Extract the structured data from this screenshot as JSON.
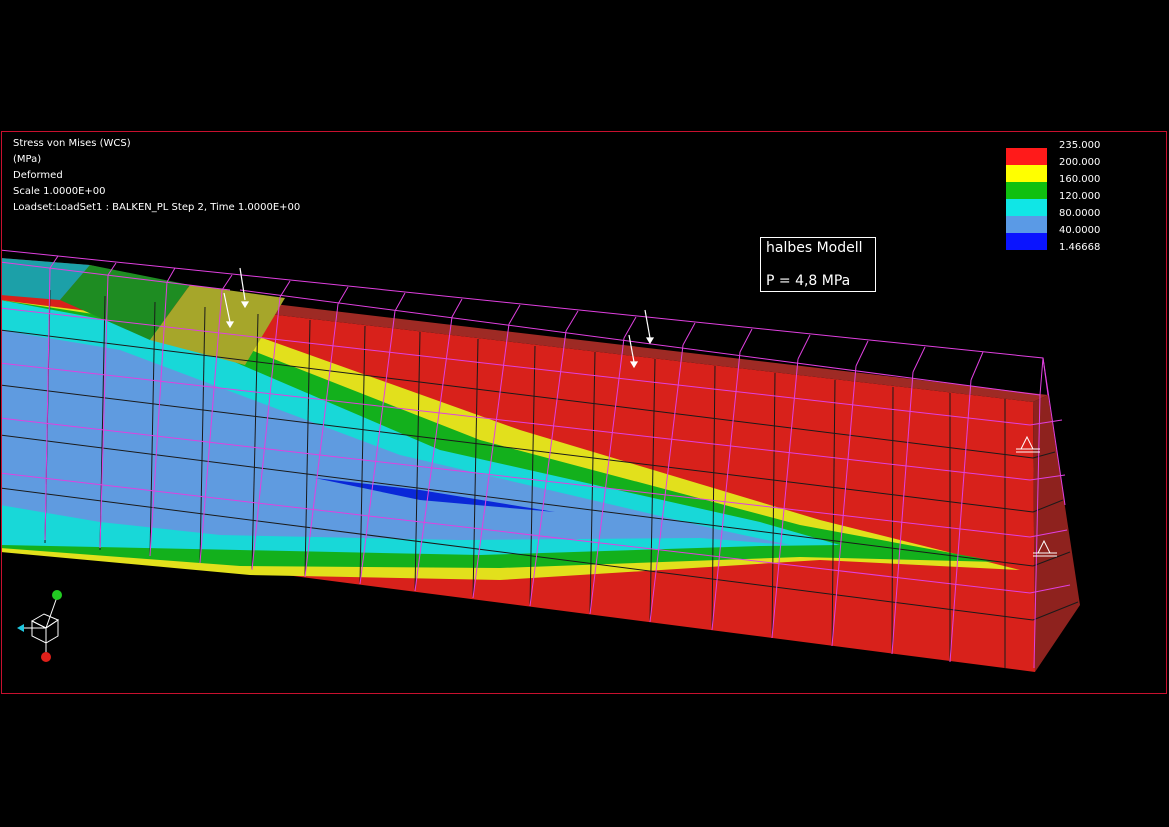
{
  "header_info": {
    "result": "Stress von Mises (WCS)",
    "unit": "(MPa)",
    "mode": "Deformed",
    "scale": "Scale  1.0000E+00",
    "loadset": "Loadset:LoadSet1 :  BALKEN_PL Step 2, Time  1.0000E+00"
  },
  "legend": {
    "labels": [
      "235.000",
      "200.000",
      "160.000",
      "120.000",
      "80.0000",
      "40.0000",
      "1.46668"
    ],
    "colors": [
      "#ff1a1a",
      "#ffff00",
      "#10c010",
      "#10e6e6",
      "#5a9ae6",
      "#0a14ff"
    ]
  },
  "annotation": {
    "line1": "halbes Modell",
    "line2": "P = 4,8 MPa"
  },
  "colors": {
    "background": "#000000",
    "frame": "#c8102e",
    "undeformed_mesh": "#e040e0",
    "mesh_lines": "#222222"
  },
  "icons": [
    "load-arrow-icon",
    "constraint-symbol-icon",
    "coordinate-triad-icon"
  ]
}
